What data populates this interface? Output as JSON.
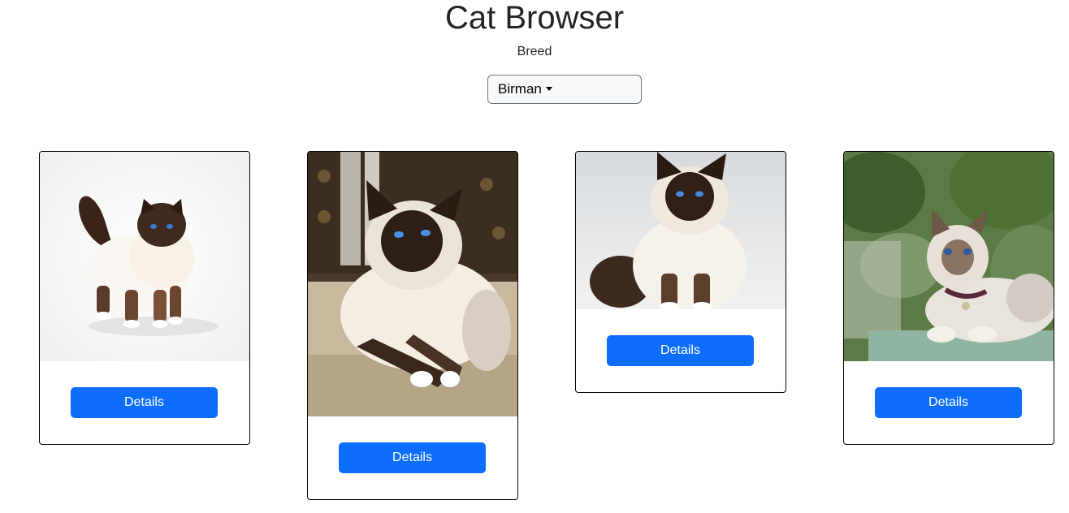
{
  "header": {
    "title": "Cat Browser",
    "breed_label": "Breed"
  },
  "breed_select": {
    "selected": "Birman"
  },
  "colors": {
    "primary_button": "#0d6efd",
    "card_border": "#000000",
    "select_bg": "#f8f9fa"
  },
  "cards": [
    {
      "image": "birman-cat-standing-white-background",
      "button_label": "Details"
    },
    {
      "image": "birman-cat-lying-on-carpet",
      "button_label": "Details"
    },
    {
      "image": "birman-cat-sitting-grey-background",
      "button_label": "Details"
    },
    {
      "image": "birman-cat-lying-outdoors-plants",
      "button_label": "Details"
    }
  ]
}
